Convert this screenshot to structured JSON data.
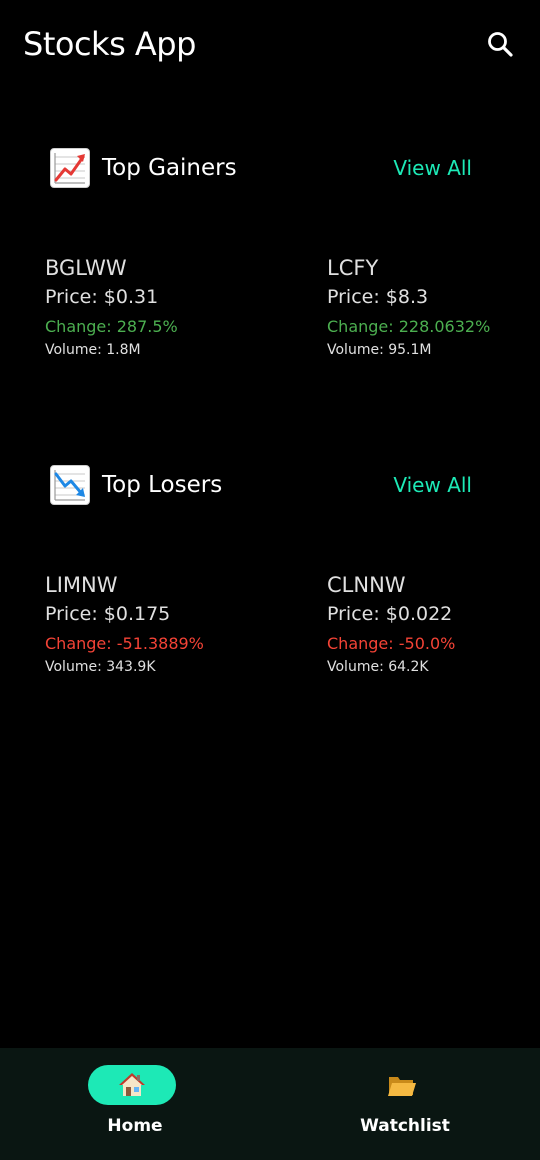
{
  "appbar": {
    "title": "Stocks App",
    "search_icon": "search-icon"
  },
  "colors": {
    "accent": "#1de9b6",
    "gain": "#4caf50",
    "loss": "#f44336",
    "background": "#000000",
    "nav_background": "#0a1612"
  },
  "top_gainers": {
    "icon": "chart-increasing-icon",
    "title": "Top Gainers",
    "view_all_label": "View All",
    "stocks": [
      {
        "symbol": "BGLWW",
        "price": "Price: $0.31",
        "change": "Change: 287.5%",
        "volume": "Volume: 1.8M"
      },
      {
        "symbol": "LCFY",
        "price": "Price: $8.3",
        "change": "Change: 228.0632%",
        "volume": "Volume: 95.1M"
      }
    ]
  },
  "top_losers": {
    "icon": "chart-decreasing-icon",
    "title": "Top Losers",
    "view_all_label": "View All",
    "stocks": [
      {
        "symbol": "LIMNW",
        "price": "Price: $0.175",
        "change": "Change: -51.3889%",
        "volume": "Volume: 343.9K"
      },
      {
        "symbol": "CLNNW",
        "price": "Price: $0.022",
        "change": "Change: -50.0%",
        "volume": "Volume: 64.2K"
      }
    ]
  },
  "bottom_nav": {
    "items": [
      {
        "label": "Home",
        "icon": "house-icon",
        "active": true
      },
      {
        "label": "Watchlist",
        "icon": "folder-icon",
        "active": false
      }
    ]
  }
}
